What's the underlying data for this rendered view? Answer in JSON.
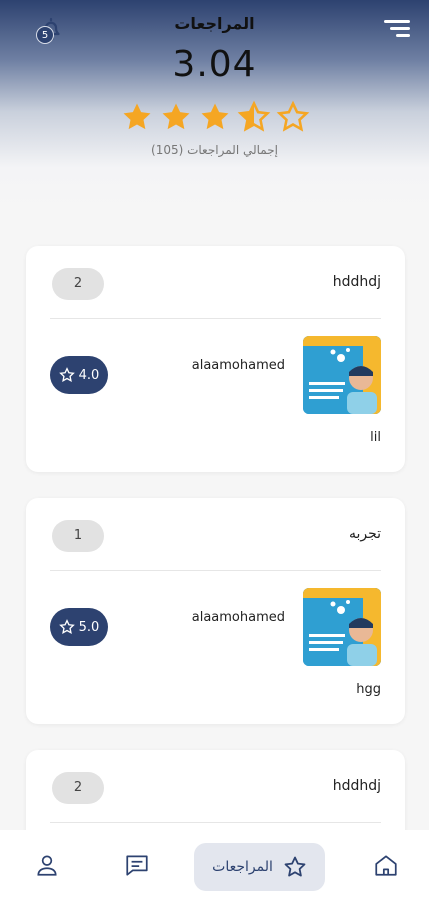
{
  "header": {
    "title": "المراجعات",
    "rating": "3.04",
    "stars_filled": 3.04,
    "stars_total": 5,
    "total_reviews": "إجمالي المراجعات (105)",
    "notification_count": "5",
    "icons": {
      "notifications": "bell-icon",
      "menu": "menu-icon"
    }
  },
  "reviews": [
    {
      "title": "hddhdj",
      "count": "2",
      "username": "alaamohamed",
      "rating": "4.0",
      "comment": "lil"
    },
    {
      "title": "تجربه",
      "count": "1",
      "username": "alaamohamed",
      "rating": "5.0",
      "comment": "hgg"
    },
    {
      "title": "hddhdj",
      "count": "2"
    }
  ],
  "bottom_nav": {
    "active_label": "المراجعات",
    "icons": [
      "home-icon",
      "star-icon",
      "chat-icon",
      "profile-icon"
    ]
  },
  "colors": {
    "primary": "#2d4270",
    "star": "#f5a623",
    "accent": "#2f9fd2"
  }
}
